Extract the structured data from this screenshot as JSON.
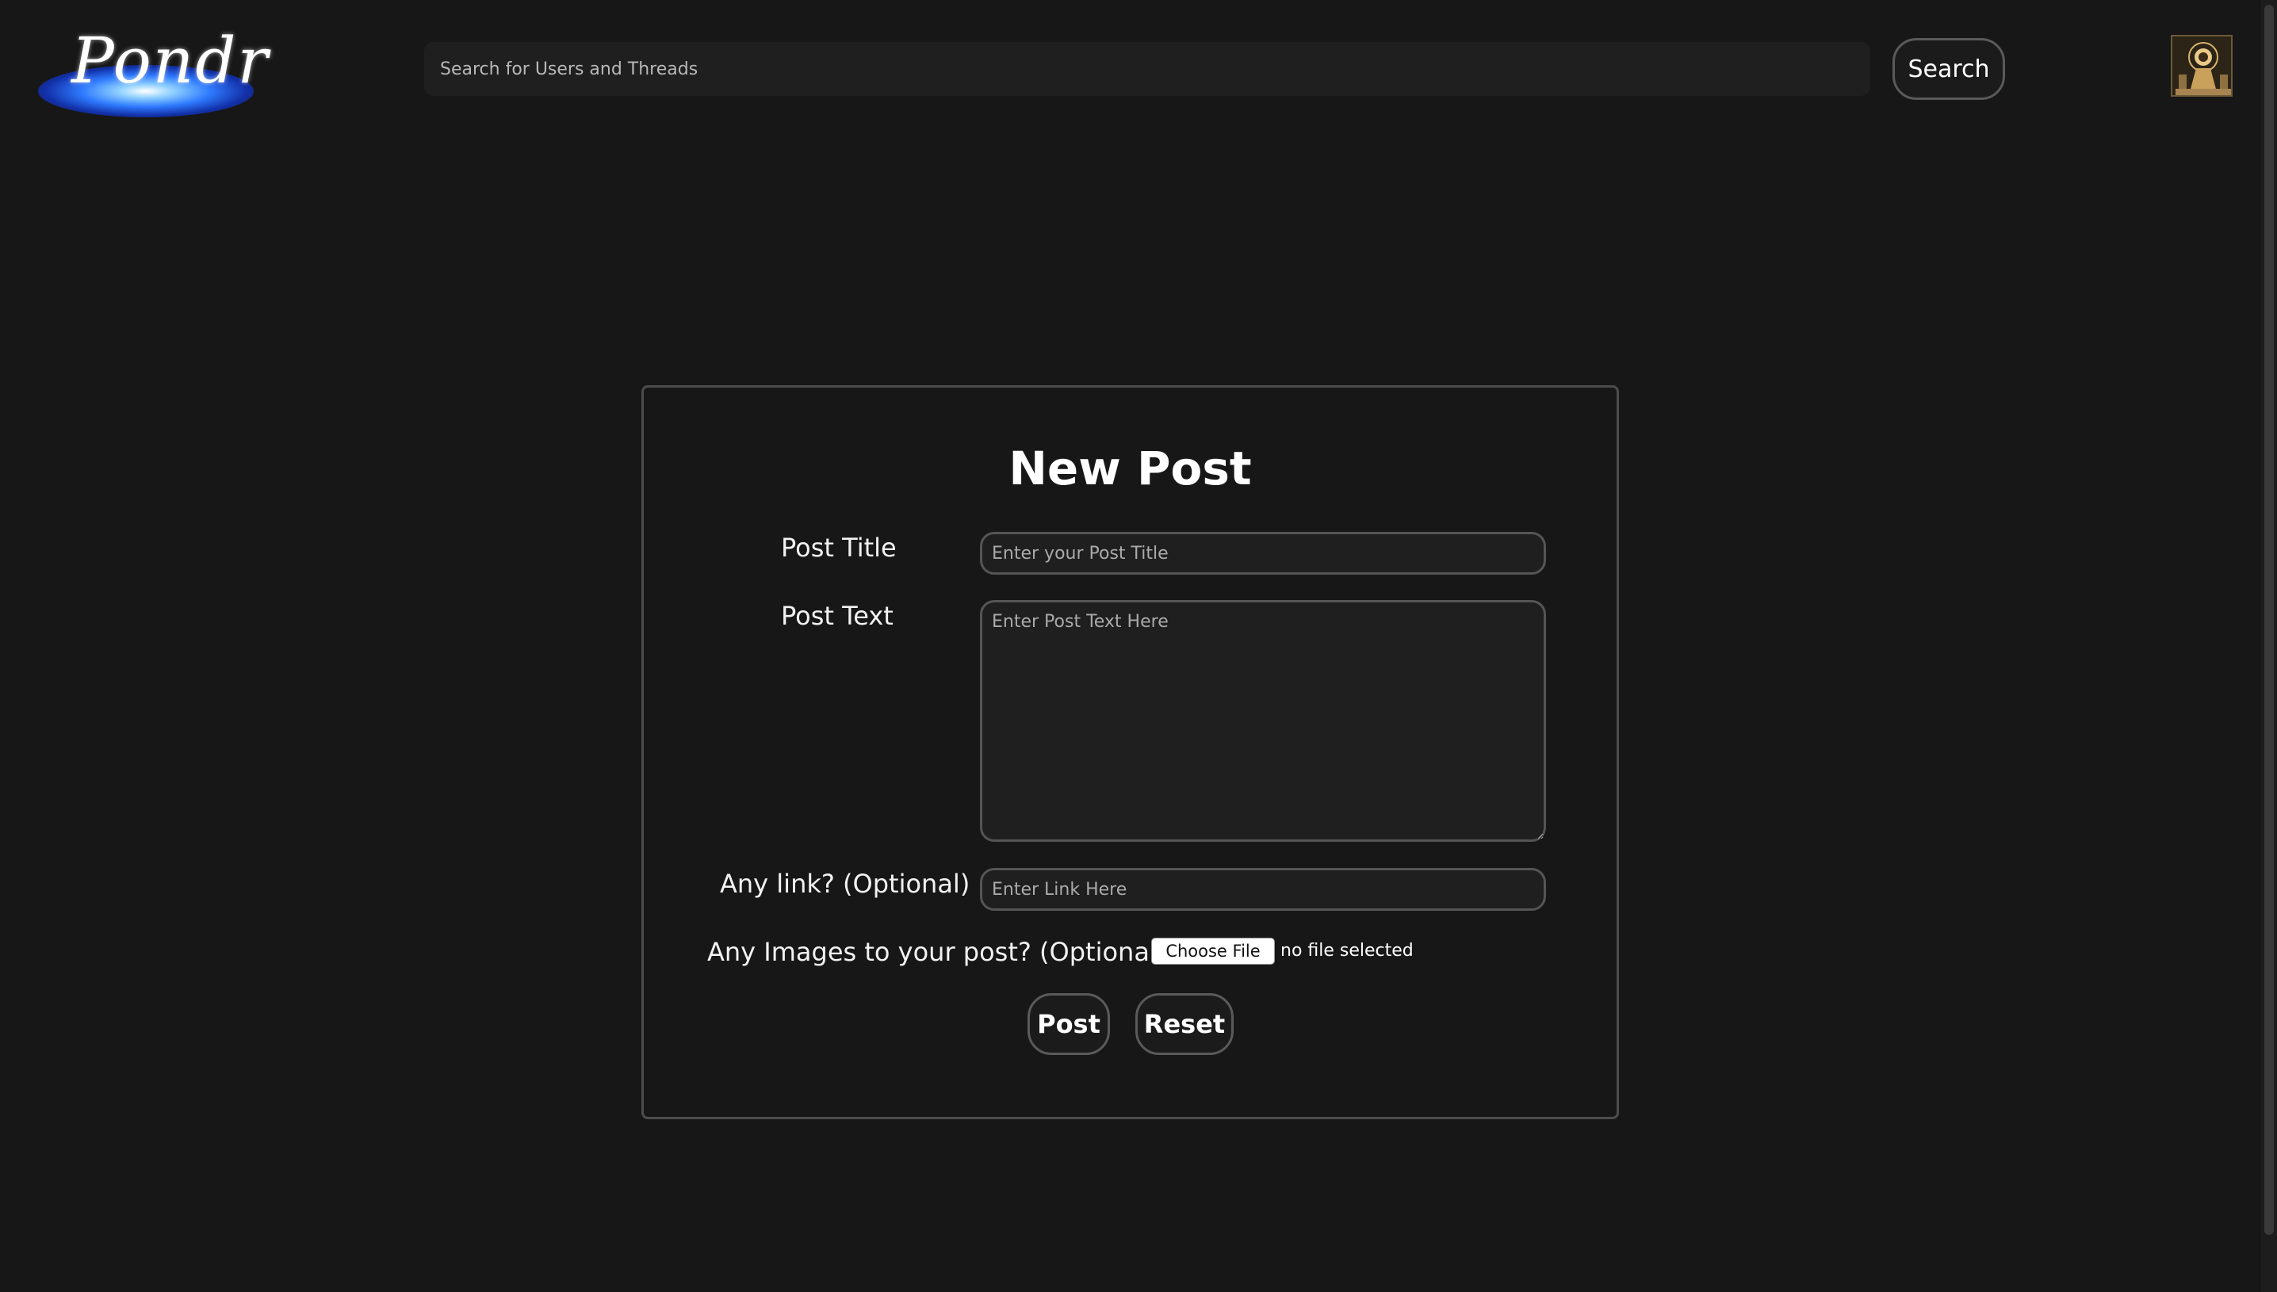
{
  "header": {
    "logo_text": "Pondr",
    "search": {
      "placeholder": "Search for Users and Threads",
      "value": ""
    },
    "search_label": "Search",
    "avatar_icon": "profile-avatar"
  },
  "form": {
    "title": "New Post",
    "post_title": {
      "label": "Post Title",
      "placeholder": "Enter your Post Title"
    },
    "post_text": {
      "label": "Post Text",
      "placeholder": "Enter Post Text Here"
    },
    "link": {
      "label": "Any link? (Optional)",
      "placeholder": "Enter Link Here"
    },
    "images": {
      "label": "Any Images to your post? (Optional)",
      "choose_label": "Choose File",
      "status": "no file selected"
    },
    "post_label": "Post",
    "reset_label": "Reset"
  },
  "colors": {
    "background": "#171717",
    "field_background": "#1f1f1f",
    "border": "#555555",
    "logo_glow": "#2f7bff"
  }
}
